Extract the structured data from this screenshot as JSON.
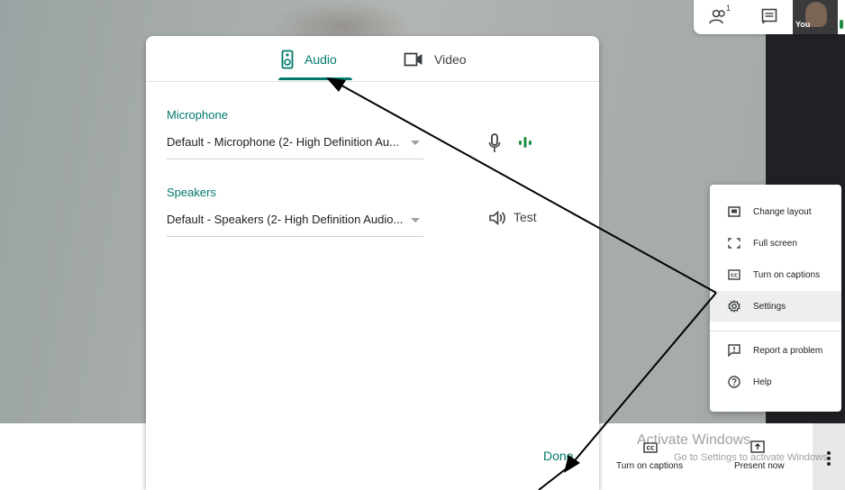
{
  "top_panel": {
    "people_count": "1",
    "self_label": "You"
  },
  "dialog": {
    "tabs": [
      {
        "label": "Audio",
        "icon": "speaker-device-icon",
        "selected": true
      },
      {
        "label": "Video",
        "icon": "video-camera-icon",
        "selected": false
      }
    ],
    "microphone": {
      "label": "Microphone",
      "value": "Default - Microphone (2- High Definition Au...",
      "icon": "microphone-icon",
      "level_icon": "audio-level-icon"
    },
    "speakers": {
      "label": "Speakers",
      "value": "Default - Speakers (2- High Definition Audio...",
      "icon": "volume-icon",
      "test_label": "Test"
    },
    "done_label": "Done"
  },
  "menu": {
    "items": [
      {
        "label": "Change layout",
        "icon": "layout-icon"
      },
      {
        "label": "Full screen",
        "icon": "fullscreen-icon"
      },
      {
        "label": "Turn on captions",
        "icon": "captions-icon"
      },
      {
        "label": "Settings",
        "icon": "gear-icon",
        "active": true
      },
      {
        "label": "Report a problem",
        "icon": "report-icon"
      },
      {
        "label": "Help",
        "icon": "help-icon"
      }
    ]
  },
  "bottom_bar": {
    "captions_label": "Turn on captions",
    "present_label": "Present now",
    "more_icon": "more-vert-icon"
  },
  "watermark": {
    "line1": "Activate Windows",
    "line2": "Go to Settings to activate Windows."
  },
  "colors": {
    "accent": "#00796b",
    "level_green": "#1e8e3e",
    "text": "#202124"
  }
}
